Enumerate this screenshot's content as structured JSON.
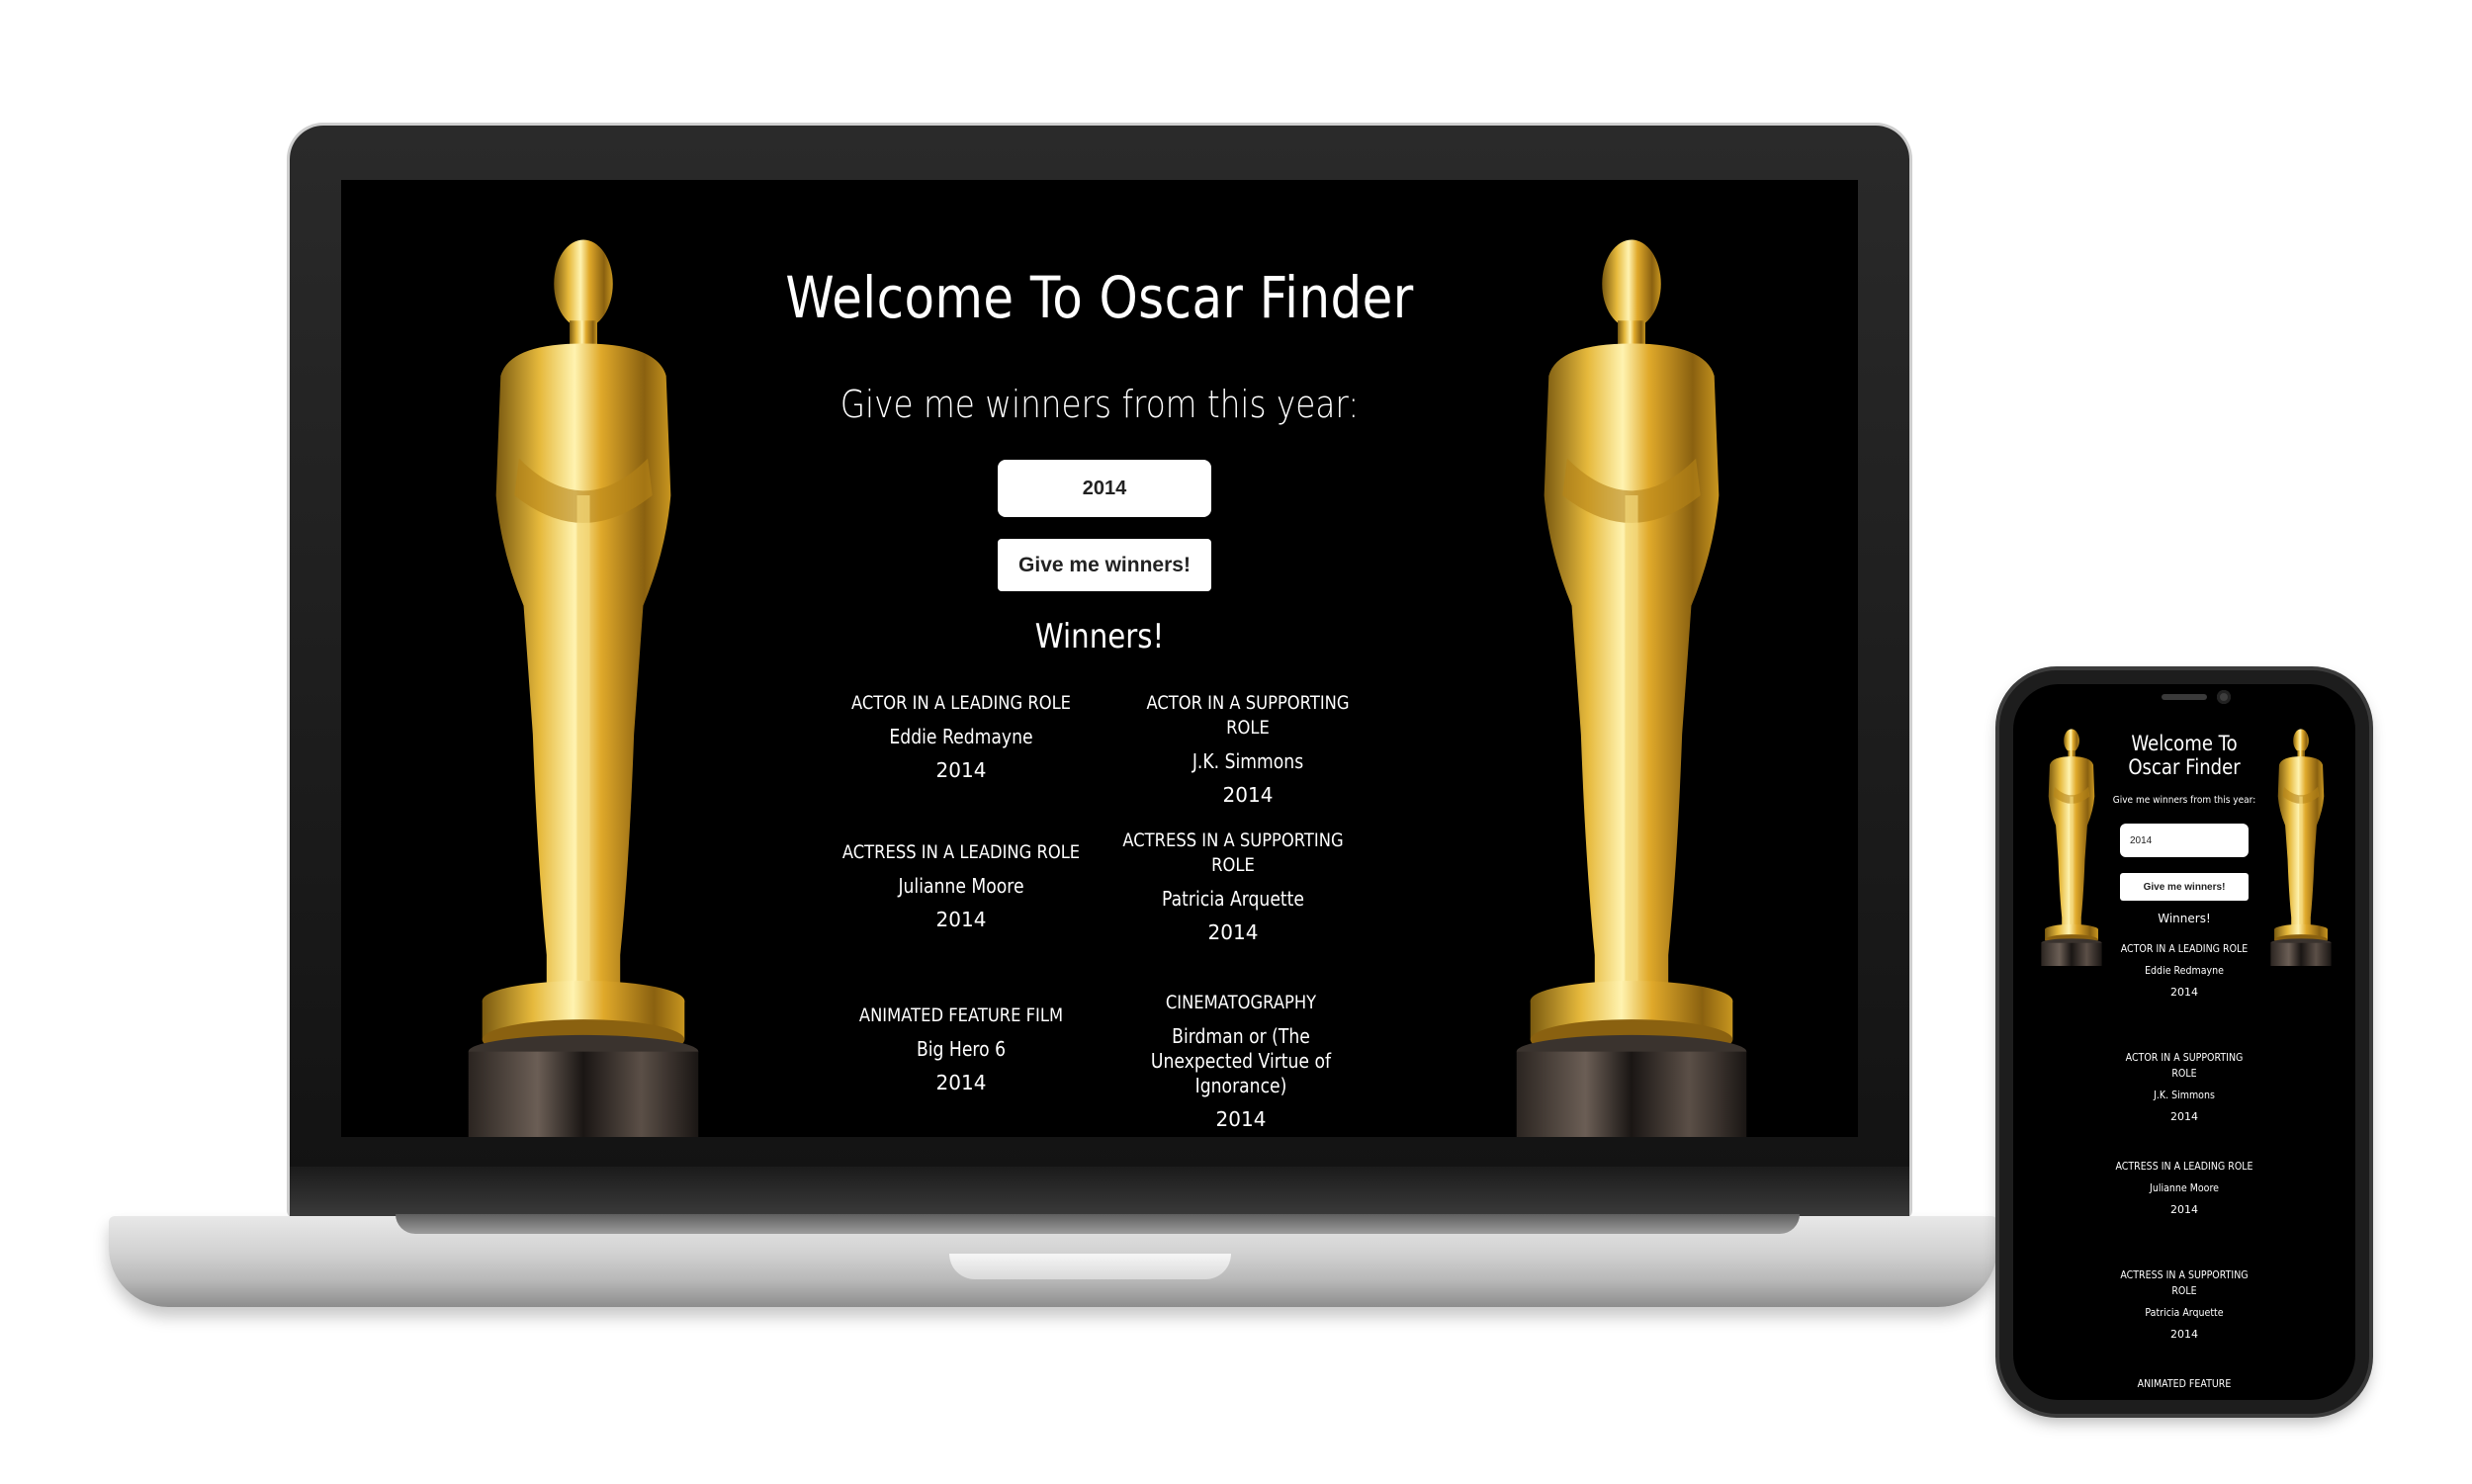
{
  "app": {
    "title": "Welcome To Oscar Finder",
    "prompt": "Give me winners from this year:",
    "year_input_value": "2014",
    "submit_label": "Give me winners!",
    "winners_heading": "Winners!"
  },
  "laptop": {
    "winners": [
      {
        "category": "ACTOR IN A LEADING ROLE",
        "nominee": "Eddie Redmayne",
        "year": "2014"
      },
      {
        "category": "ACTOR IN A SUPPORTING ROLE",
        "nominee": "J.K. Simmons",
        "year": "2014"
      },
      {
        "category": "ACTRESS IN A LEADING ROLE",
        "nominee": "Julianne Moore",
        "year": "2014"
      },
      {
        "category": "ACTRESS IN A SUPPORTING ROLE",
        "nominee": "Patricia Arquette",
        "year": "2014"
      },
      {
        "category": "ANIMATED FEATURE FILM",
        "nominee": "Big Hero 6",
        "year": "2014"
      },
      {
        "category": "CINEMATOGRAPHY",
        "nominee": "Birdman or (The Unexpected Virtue of Ignorance)",
        "year": "2014"
      }
    ]
  },
  "phone": {
    "title": "Welcome To Oscar Finder",
    "prompt": "Give me winners from this year:",
    "year_input_value": "2014",
    "submit_label": "Give me winners!",
    "winners_heading": "Winners!",
    "winners": [
      {
        "category": "ACTOR IN A LEADING ROLE",
        "nominee": "Eddie Redmayne",
        "year": "2014"
      },
      {
        "category": "ACTOR IN A SUPPORTING ROLE",
        "nominee": "J.K. Simmons",
        "year": "2014"
      },
      {
        "category": "ACTRESS IN A LEADING ROLE",
        "nominee": "Julianne Moore",
        "year": "2014"
      },
      {
        "category": "ACTRESS IN A SUPPORTING ROLE",
        "nominee": "Patricia Arquette",
        "year": "2014"
      },
      {
        "category": "ANIMATED FEATURE",
        "nominee": "",
        "year": ""
      }
    ]
  },
  "colors": {
    "background": "#000000",
    "text": "#ffffff",
    "gold": "#d4a52a"
  }
}
